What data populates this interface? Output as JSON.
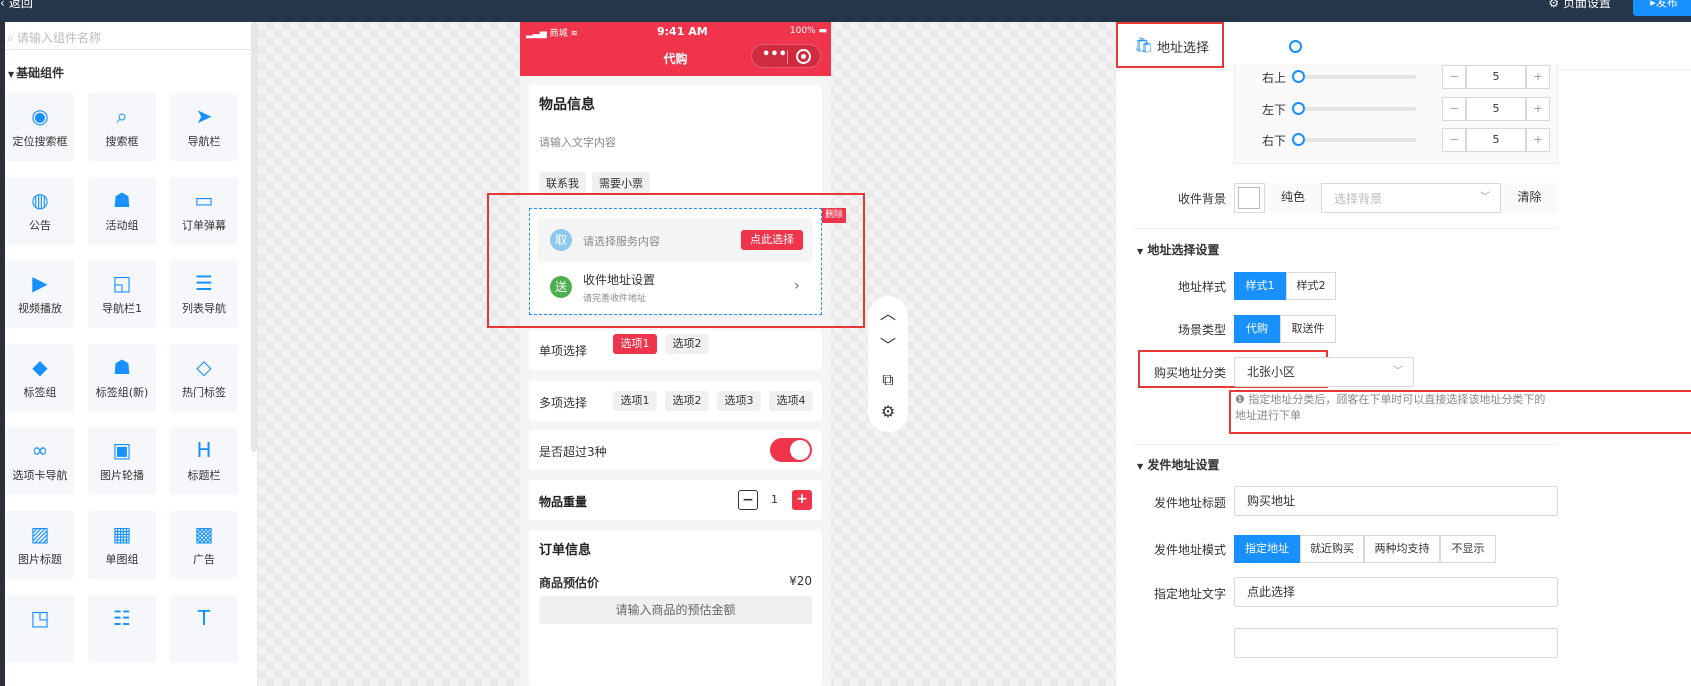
{
  "topbar": {
    "back_label": "返回",
    "settings_label": "页面设置",
    "publish_label": "发布"
  },
  "sidebar": {
    "search_placeholder": "请输入组件名称",
    "group_title": "基础组件",
    "items": [
      {
        "label": "定位搜索框",
        "icon": "location-search-icon"
      },
      {
        "label": "搜索框",
        "icon": "search-box-icon"
      },
      {
        "label": "导航栏",
        "icon": "navigation-arrow-icon"
      },
      {
        "label": "公告",
        "icon": "announcement-icon"
      },
      {
        "label": "活动组",
        "icon": "activity-group-icon"
      },
      {
        "label": "订单弹幕",
        "icon": "order-barrage-icon"
      },
      {
        "label": "视频播放",
        "icon": "video-play-icon"
      },
      {
        "label": "导航栏1",
        "icon": "navbar1-icon"
      },
      {
        "label": "列表导航",
        "icon": "list-nav-icon"
      },
      {
        "label": "标签组",
        "icon": "tag-group-icon"
      },
      {
        "label": "标签组(新)",
        "icon": "tag-group-new-icon"
      },
      {
        "label": "热门标签",
        "icon": "hot-tag-icon"
      },
      {
        "label": "选项卡导航",
        "icon": "tab-nav-icon"
      },
      {
        "label": "图片轮播",
        "icon": "image-carousel-icon"
      },
      {
        "label": "标题栏",
        "icon": "title-bar-icon"
      },
      {
        "label": "图片标题",
        "icon": "image-title-icon"
      },
      {
        "label": "单图组",
        "icon": "single-image-icon"
      },
      {
        "label": "广告",
        "icon": "ad-icon"
      },
      {
        "label": "",
        "icon": "layout-icon"
      },
      {
        "label": "",
        "icon": "stack-icon"
      },
      {
        "label": "",
        "icon": "text-icon"
      }
    ]
  },
  "phone": {
    "carrier": "商城",
    "time": "9:41 AM",
    "battery": "100%",
    "title": "代购",
    "item_info_title": "物品信息",
    "item_info_placeholder": "请输入文字内容",
    "tags": [
      "联系我",
      "需要小票"
    ],
    "delete_badge": "删除",
    "service_circle": "取",
    "service_placeholder": "请选择服务内容",
    "service_button": "点此选择",
    "address_circle": "送",
    "address_title": "收件地址设置",
    "address_sub": "请完善收件地址",
    "single_label": "单项选择",
    "single_options": [
      "选项1",
      "选项2"
    ],
    "multi_label": "多项选择",
    "multi_options": [
      "选项1",
      "选项2",
      "选项3",
      "选项4"
    ],
    "switch_label": "是否超过3种",
    "weight_label": "物品重量",
    "weight_value": "1",
    "order_title": "订单信息",
    "price_label": "商品预估价",
    "price_value": "¥20",
    "price_placeholder": "请输入商品的预估金额"
  },
  "rightpanel": {
    "header_title": "地址选择",
    "radius_rows": [
      {
        "label": "右上",
        "value": "5"
      },
      {
        "label": "左下",
        "value": "5"
      },
      {
        "label": "右下",
        "value": "5"
      }
    ],
    "bg_label": "收件背景",
    "bg_solid": "纯色",
    "bg_placeholder": "选择背景",
    "bg_clear": "清除",
    "address_section": "地址选择设置",
    "style_label": "地址样式",
    "style_options": [
      "样式1",
      "样式2"
    ],
    "scene_label": "场景类型",
    "scene_options": [
      "代购",
      "取送件"
    ],
    "category_label": "购买地址分类",
    "category_value": "北张小区",
    "hint_text": "指定地址分类后，顾客在下单时可以直接选择该地址分类下的",
    "hint_text2": "地址进行下单",
    "ship_section": "发件地址设置",
    "ship_title_label": "发件地址标题",
    "ship_title_value": "购买地址",
    "ship_mode_label": "发件地址模式",
    "ship_mode_options": [
      "指定地址",
      "就近购买",
      "两种均支持",
      "不显示"
    ],
    "fixed_text_label": "指定地址文字",
    "fixed_text_value": "点此选择"
  }
}
